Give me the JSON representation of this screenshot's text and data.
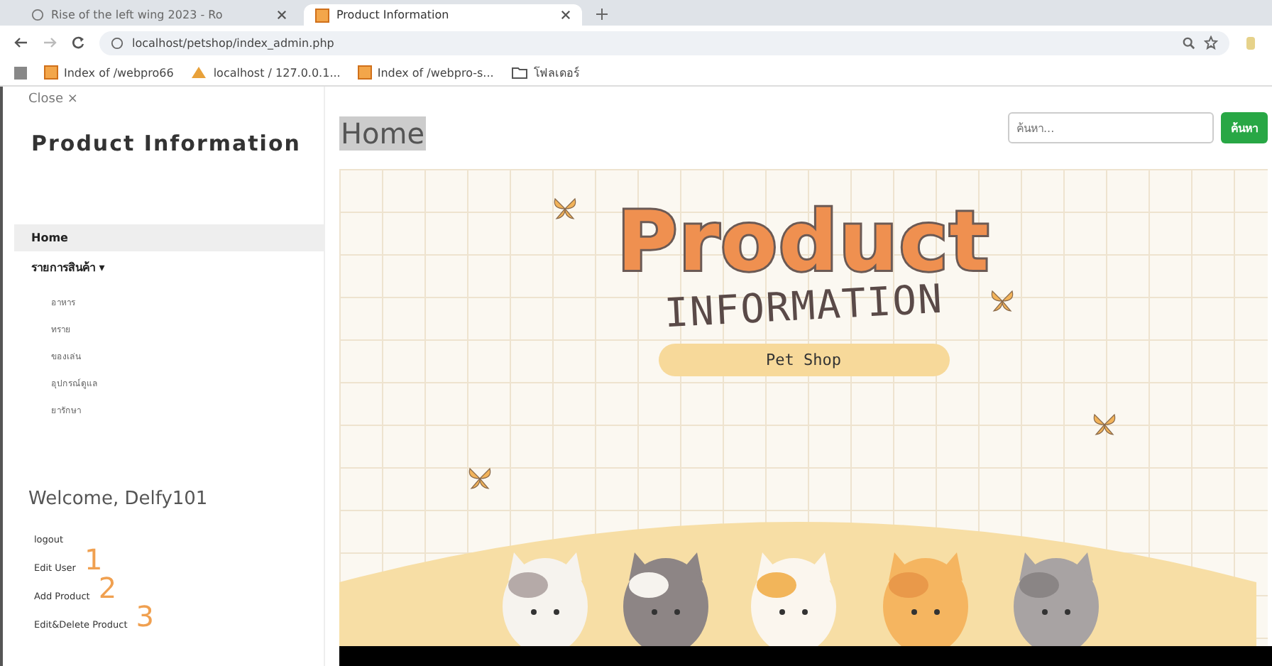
{
  "browser": {
    "tabs": [
      {
        "title": "Rise of the left wing 2023 - Ro",
        "selected": false
      },
      {
        "title": "Product Information",
        "selected": true
      }
    ],
    "url": "localhost/petshop/index_admin.php",
    "bookmarks": [
      {
        "kind": "page",
        "label": "Index of /webpro66"
      },
      {
        "kind": "db",
        "label": "localhost / 127.0.0.1..."
      },
      {
        "kind": "page",
        "label": "Index of /webpro-s..."
      },
      {
        "kind": "folder",
        "label": "โฟลเดอร์"
      }
    ]
  },
  "sidebar": {
    "close": "Close ×",
    "title": "Product Information",
    "menu": [
      {
        "label": "Home",
        "selected": true
      },
      {
        "label": "รายการสินค้า ▾",
        "selected": false
      }
    ],
    "submenu": [
      "อาหาร",
      "ทราย",
      "ของเล่น",
      "อุปกรณ์ดูแล",
      "ยารักษา"
    ],
    "welcome": "Welcome, Delfy101",
    "links": [
      {
        "label": "logout"
      },
      {
        "label": "Edit User",
        "annotation": "1"
      },
      {
        "label": "Add Product",
        "annotation": "2"
      },
      {
        "label": "Edit&Delete Product",
        "annotation": "3"
      }
    ]
  },
  "main": {
    "heading": "Home",
    "search": {
      "placeholder": "ค้นหา...",
      "button": "ค้นหา"
    },
    "banner": {
      "title": "Product",
      "subtitle": "INFORMATION",
      "tag": "Pet Shop"
    }
  }
}
